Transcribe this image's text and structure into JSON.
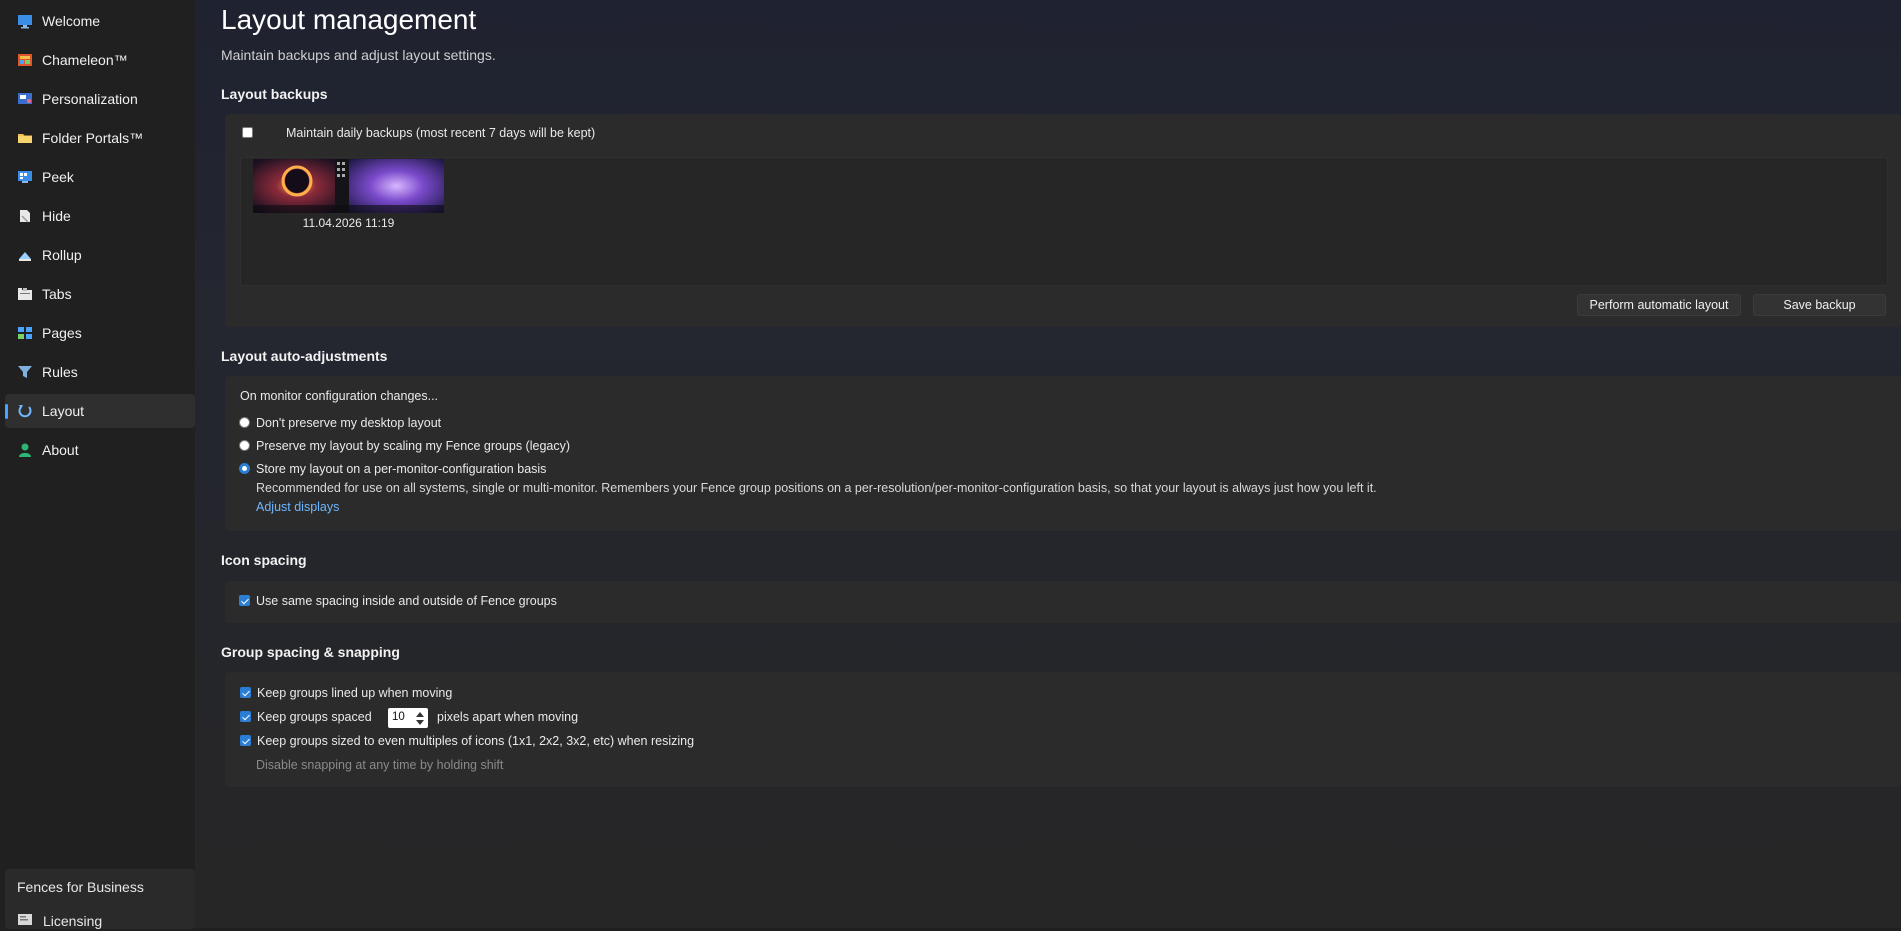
{
  "sidebar": {
    "items": [
      {
        "label": "Welcome",
        "icon": "monitor-icon"
      },
      {
        "label": "Chameleon™",
        "icon": "chameleon-icon"
      },
      {
        "label": "Personalization",
        "icon": "personalization-icon"
      },
      {
        "label": "Folder Portals™",
        "icon": "folder-icon"
      },
      {
        "label": "Peek",
        "icon": "peek-icon"
      },
      {
        "label": "Hide",
        "icon": "hide-icon"
      },
      {
        "label": "Rollup",
        "icon": "rollup-icon"
      },
      {
        "label": "Tabs",
        "icon": "tabs-icon"
      },
      {
        "label": "Pages",
        "icon": "pages-icon"
      },
      {
        "label": "Rules",
        "icon": "filter-icon"
      },
      {
        "label": "Layout",
        "icon": "layout-icon",
        "active": true
      },
      {
        "label": "About",
        "icon": "person-icon"
      }
    ],
    "business_title": "Fences for Business",
    "licensing_label": "Licensing"
  },
  "page": {
    "title": "Layout management",
    "subtitle": "Maintain backups and adjust layout settings."
  },
  "backups": {
    "title": "Layout backups",
    "daily_label": "Maintain daily backups (most recent 7 days will be kept)",
    "daily_checked": false,
    "items": [
      {
        "timestamp": "11.04.2026 11:19"
      }
    ],
    "auto_layout_label": "Perform automatic layout",
    "save_label": "Save backup"
  },
  "auto_adjust": {
    "title": "Layout auto-adjustments",
    "intro": "On monitor configuration changes...",
    "options": [
      {
        "label": "Don't preserve my desktop layout",
        "selected": false
      },
      {
        "label": "Preserve my layout by scaling my Fence groups (legacy)",
        "selected": false
      },
      {
        "label": "Store my layout on a per-monitor-configuration basis",
        "selected": true
      }
    ],
    "description": "Recommended for use on all systems, single or multi-monitor. Remembers your Fence group positions on a per-resolution/per-monitor-configuration basis, so that your layout is always just how you left it.",
    "adjust_link": "Adjust displays"
  },
  "icon_spacing": {
    "title": "Icon spacing",
    "same_spacing_label": "Use same spacing inside and outside of Fence groups",
    "same_spacing_checked": true
  },
  "group_spacing": {
    "title": "Group spacing & snapping",
    "lined_up_label": "Keep groups lined up when moving",
    "spaced_label": "Keep groups spaced",
    "spaced_value": "10",
    "spaced_suffix": "pixels apart when moving",
    "sized_label": "Keep groups sized to even multiples of icons (1x1, 2x2, 3x2, etc) when resizing",
    "hint": "Disable snapping at any time by holding shift"
  },
  "colors": {
    "accent": "#2a7fd4",
    "link": "#6fb6ff",
    "background": "#202020"
  }
}
